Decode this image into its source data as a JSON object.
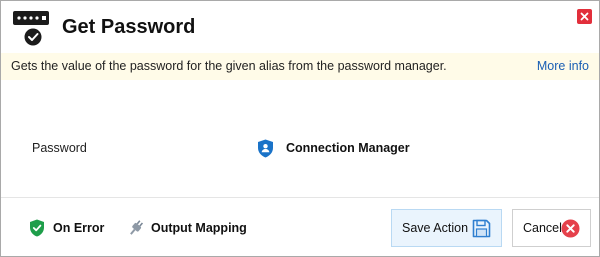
{
  "header": {
    "title": "Get Password",
    "app_icon": "password-check-icon",
    "close_icon": "close-icon"
  },
  "info_bar": {
    "description": "Gets the value of the password for the given alias from the password manager.",
    "link": "More info"
  },
  "form": {
    "password_label": "Password",
    "password_value": "Connection Manager",
    "password_value_icon": "shield-user-icon"
  },
  "footer": {
    "on_error": "On Error",
    "on_error_icon": "shield-check-icon",
    "output_mapping": "Output Mapping",
    "output_mapping_icon": "plug-icon",
    "save": "Save Action",
    "save_icon": "floppy-disk-icon",
    "cancel": "Cancel",
    "cancel_icon": "close-circle-icon"
  },
  "colors": {
    "info_bar_bg": "#fffbe8",
    "link": "#1a5fb4",
    "close": "#e22f3b",
    "save_bg": "#eaf4fd",
    "shield_green": "#1e9e4a",
    "shield_blue": "#1a73c8"
  }
}
